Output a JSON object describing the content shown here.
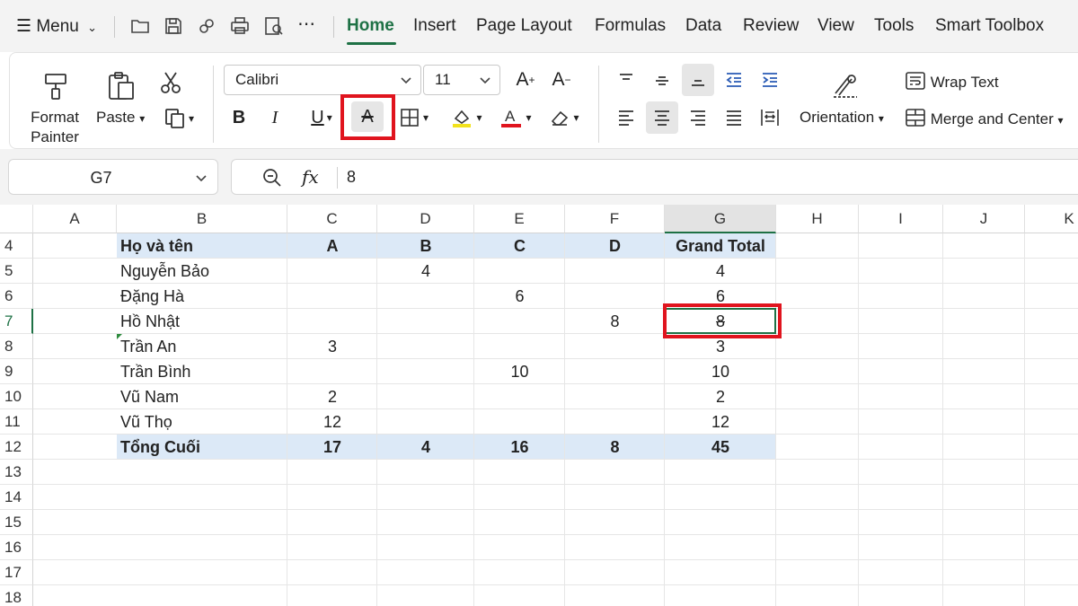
{
  "menubar": {
    "menu_label": "Menu",
    "tabs": [
      {
        "label": "Home",
        "active": true
      },
      {
        "label": "Insert"
      },
      {
        "label": "Page Layout"
      },
      {
        "label": "Formulas"
      },
      {
        "label": "Data"
      },
      {
        "label": "Review"
      },
      {
        "label": "View"
      },
      {
        "label": "Tools"
      },
      {
        "label": "Smart Toolbox"
      }
    ],
    "quick_icons": [
      "folder-icon",
      "save-icon",
      "link-icon",
      "print-icon",
      "print-preview-icon",
      "more-icon"
    ]
  },
  "ribbon": {
    "format_painter_line1": "Format",
    "format_painter_line2": "Painter",
    "paste_label": "Paste",
    "font_name": "Calibri",
    "font_size": "11",
    "orientation_label": "Orientation",
    "wrap_text_label": "Wrap Text",
    "merge_center_label": "Merge and Center",
    "highlighted_tool": "strikethrough-icon",
    "accent_color": "#1e7145",
    "highlight_color": "#e0141e",
    "fill_color": "#f2e21c",
    "font_color": "#e0141e"
  },
  "formula_bar": {
    "name_box": "G7",
    "fx_label": "fx",
    "value": "8"
  },
  "sheet": {
    "columns": [
      "A",
      "B",
      "C",
      "D",
      "E",
      "F",
      "G",
      "H",
      "I",
      "J",
      "K"
    ],
    "selected_column": "G",
    "row_numbers": [
      "4",
      "5",
      "6",
      "7",
      "8",
      "9",
      "10",
      "11",
      "12",
      "13",
      "14",
      "15",
      "16",
      "17",
      "18"
    ],
    "selected_row": "7",
    "header_row": {
      "name": "Họ và tên",
      "A": "A",
      "B": "B",
      "C": "C",
      "D": "D",
      "total": "Grand Total"
    },
    "rows": [
      {
        "name": "Nguyễn Bảo",
        "A": "",
        "B": "4",
        "C": "",
        "D": "",
        "total": "4"
      },
      {
        "name": "Đặng Hà",
        "A": "",
        "B": "",
        "C": "6",
        "D": "",
        "total": "6"
      },
      {
        "name": "Hồ Nhật",
        "A": "",
        "B": "",
        "C": "",
        "D": "8",
        "total": "8"
      },
      {
        "name": "Trần An",
        "A": "3",
        "B": "",
        "C": "",
        "D": "",
        "total": "3"
      },
      {
        "name": "Trần Bình",
        "A": "",
        "B": "",
        "C": "10",
        "D": "",
        "total": "10"
      },
      {
        "name": "Vũ Nam",
        "A": "2",
        "B": "",
        "C": "",
        "D": "",
        "total": "2"
      },
      {
        "name": "Vũ Thọ",
        "A": "12",
        "B": "",
        "C": "",
        "D": "",
        "total": "12"
      }
    ],
    "total_row": {
      "name": "Tổng Cuối",
      "A": "17",
      "B": "4",
      "C": "16",
      "D": "8",
      "total": "45"
    },
    "band_color": "#dce9f7"
  }
}
